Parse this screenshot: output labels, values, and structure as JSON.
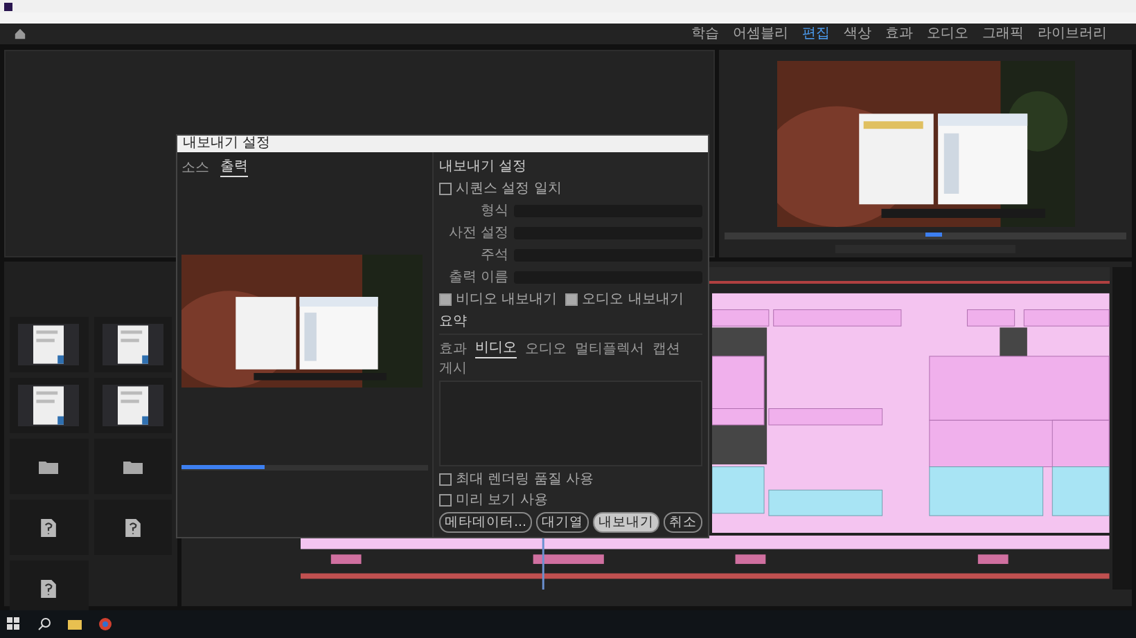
{
  "workspaces": [
    {
      "label": "학습",
      "selected": false
    },
    {
      "label": "어셈블리",
      "selected": false
    },
    {
      "label": "편집",
      "selected": true
    },
    {
      "label": "색상",
      "selected": false
    },
    {
      "label": "효과",
      "selected": false
    },
    {
      "label": "오디오",
      "selected": false
    },
    {
      "label": "그래픽",
      "selected": false
    },
    {
      "label": "라이브러리",
      "selected": false
    }
  ],
  "project_items": [
    {
      "kind": "picture"
    },
    {
      "kind": "picture"
    },
    {
      "kind": "picture"
    },
    {
      "kind": "picture"
    },
    {
      "kind": "folder"
    },
    {
      "kind": "folder"
    },
    {
      "kind": "file"
    },
    {
      "kind": "file"
    },
    {
      "kind": "file"
    }
  ],
  "export_dialog": {
    "title": "내보내기 설정",
    "source_tabs": [
      {
        "label": "소스",
        "selected": false
      },
      {
        "label": "출력",
        "selected": true
      }
    ],
    "section": "내보내기 설정",
    "match_sequence": {
      "label": "시퀀스 설정 일치",
      "checked": false
    },
    "fields": [
      {
        "label": "형식"
      },
      {
        "label": "사전 설정"
      },
      {
        "label": "주석"
      },
      {
        "label": "출력 이름"
      }
    ],
    "export_checks": [
      {
        "label": "비디오 내보내기",
        "checked": true
      },
      {
        "label": "오디오 내보내기",
        "checked": true
      }
    ],
    "summary": "요약",
    "tabs": [
      {
        "label": "효과",
        "selected": false
      },
      {
        "label": "비디오",
        "selected": true
      },
      {
        "label": "오디오",
        "selected": false
      },
      {
        "label": "멀티플렉서",
        "selected": false
      },
      {
        "label": "캡션",
        "selected": false
      },
      {
        "label": "게시",
        "selected": false
      }
    ],
    "render_options": [
      {
        "label": "최대 렌더링 품질 사용",
        "checked": false
      },
      {
        "label": "미리 보기 사용",
        "checked": false
      }
    ],
    "buttons": [
      {
        "label": "메타데이터...",
        "kind": "normal"
      },
      {
        "label": "대기열",
        "kind": "normal"
      },
      {
        "label": "내보내기",
        "kind": "primary"
      },
      {
        "label": "취소",
        "kind": "normal"
      }
    ]
  }
}
